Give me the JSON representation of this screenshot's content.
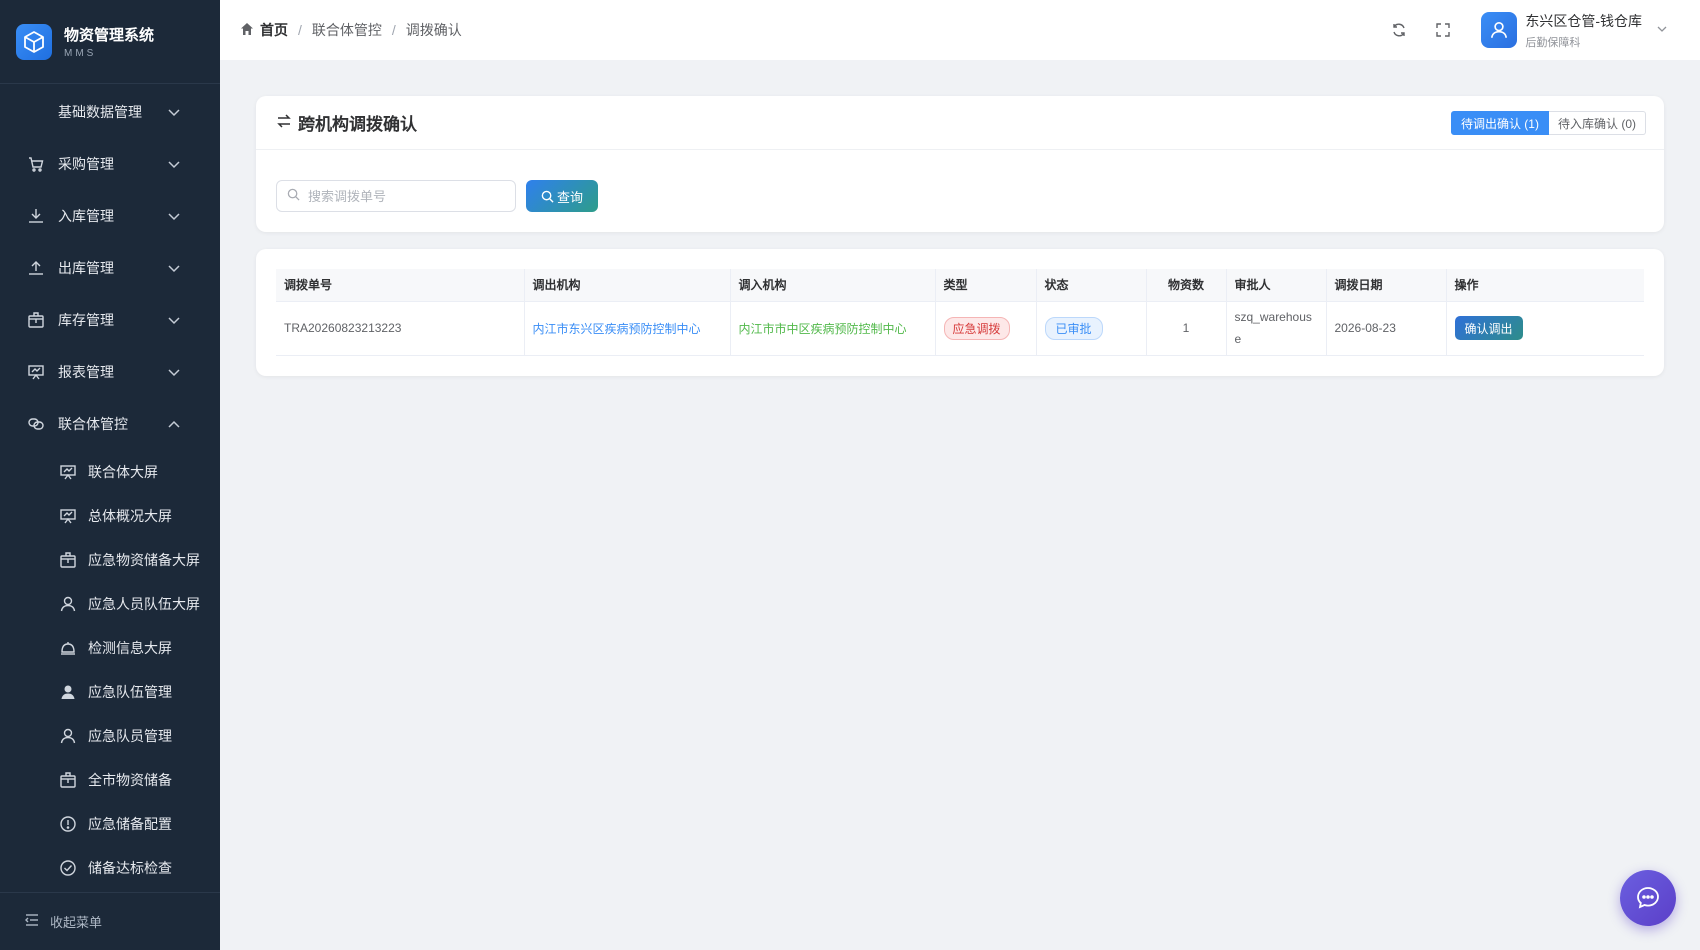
{
  "app": {
    "title": "物资管理系统",
    "subtitle": "MMS"
  },
  "sidebar": {
    "items": [
      {
        "label": "基础数据管理",
        "icon": "none",
        "expanded": false
      },
      {
        "label": "采购管理",
        "icon": "cart-icon",
        "expanded": false
      },
      {
        "label": "入库管理",
        "icon": "download-icon",
        "expanded": false
      },
      {
        "label": "出库管理",
        "icon": "upload-icon",
        "expanded": false
      },
      {
        "label": "库存管理",
        "icon": "box-icon",
        "expanded": false
      },
      {
        "label": "报表管理",
        "icon": "presentation-icon",
        "expanded": false
      },
      {
        "label": "联合体管控",
        "icon": "link-icon",
        "expanded": true
      }
    ],
    "sub_items": [
      {
        "label": "联合体大屏",
        "icon": "screen-icon"
      },
      {
        "label": "总体概况大屏",
        "icon": "screen-icon"
      },
      {
        "label": "应急物资储备大屏",
        "icon": "box-icon"
      },
      {
        "label": "应急人员队伍大屏",
        "icon": "user-icon"
      },
      {
        "label": "检测信息大屏",
        "icon": "bell-icon"
      },
      {
        "label": "应急队伍管理",
        "icon": "user-filled-icon"
      },
      {
        "label": "应急队员管理",
        "icon": "user-icon"
      },
      {
        "label": "全市物资储备",
        "icon": "box-icon"
      },
      {
        "label": "应急储备配置",
        "icon": "warning-icon"
      },
      {
        "label": "储备达标检查",
        "icon": "check-circle-icon"
      }
    ],
    "collapse_label": "收起菜单"
  },
  "header": {
    "breadcrumb": {
      "home": "首页",
      "level1": "联合体管控",
      "current": "调拨确认"
    },
    "user": {
      "name": "东兴区仓管-钱仓库",
      "dept": "后勤保障科"
    }
  },
  "main": {
    "title": "跨机构调拨确认",
    "tabs": [
      {
        "label": "待调出确认 (1)",
        "active": true
      },
      {
        "label": "待入库确认 (0)",
        "active": false
      }
    ],
    "search": {
      "placeholder": "搜索调拨单号",
      "value": ""
    },
    "query_label": "查询",
    "table": {
      "columns": [
        "调拨单号",
        "调出机构",
        "调入机构",
        "类型",
        "状态",
        "物资数",
        "审批人",
        "调拨日期",
        "操作"
      ],
      "rows": [
        {
          "id": "TRA20260823213223",
          "from": "内江市东兴区疾病预防控制中心",
          "to": "内江市市中区疾病预防控制中心",
          "type": "应急调拨",
          "status": "已审批",
          "count": "1",
          "approver": "szq_warehouse",
          "date": "2026-08-23",
          "action": "确认调出"
        }
      ]
    }
  },
  "colors": {
    "sidebar_bg": "#1c2939",
    "primary": "#3a8ef6",
    "accent_green": "#52b94b",
    "danger": "#d63a3a"
  }
}
